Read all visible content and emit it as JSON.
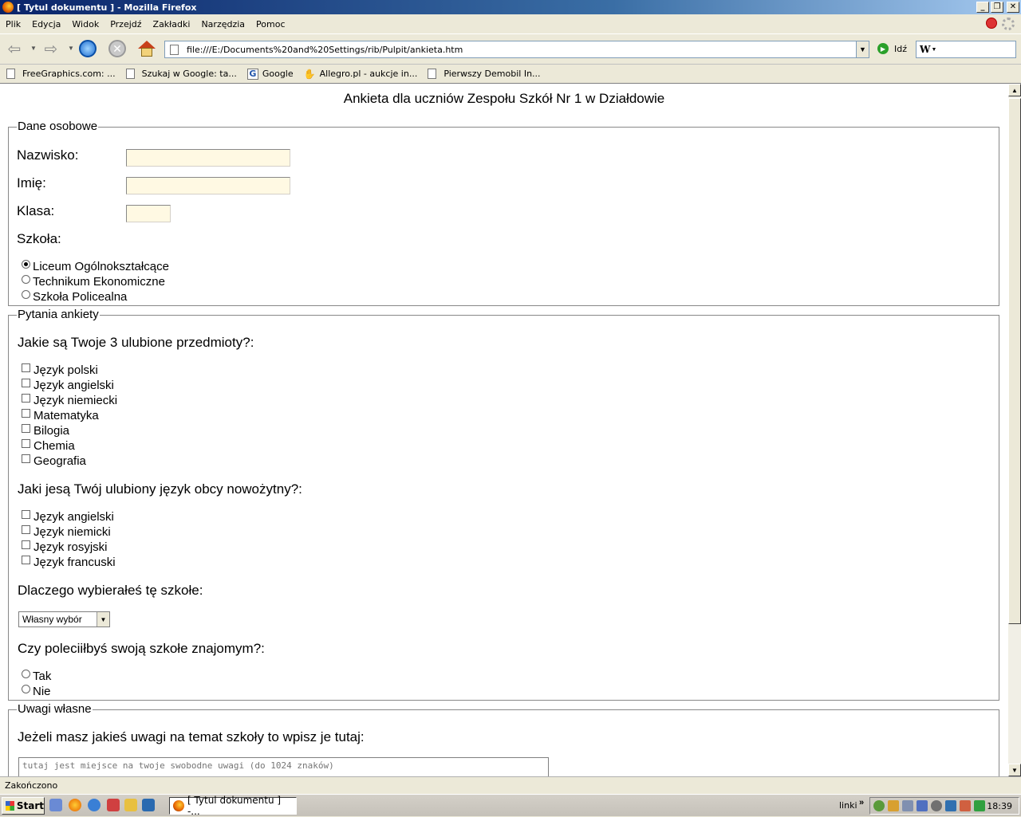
{
  "window": {
    "title": "[ Tytul dokumentu ] - Mozilla Firefox"
  },
  "menu": [
    "Plik",
    "Edycja",
    "Widok",
    "Przejdź",
    "Zakładki",
    "Narzędzia",
    "Pomoc"
  ],
  "nav": {
    "url": "file:///E:/Documents%20and%20Settings/rib/Pulpit/ankieta.htm",
    "go_label": "Idź",
    "search_logo": "W"
  },
  "bookmarks": [
    "FreeGraphics.com: ...",
    "Szukaj w Google: ta...",
    "Google",
    "Allegro.pl - aukcje in...",
    "Pierwszy Demobil In..."
  ],
  "page": {
    "title": "Ankieta dla uczniów Zespołu Szkół Nr 1 w Działdowie",
    "personal": {
      "legend": "Dane osobowe",
      "surname_label": "Nazwisko:",
      "name_label": "Imię:",
      "class_label": "Klasa:",
      "surname_value": "",
      "name_value": "",
      "class_value": "",
      "school_label": "Szkoła:",
      "schools": [
        "Liceum Ogólnokształcące",
        "Technikum Ekonomiczne",
        "Szkoła Policealna"
      ],
      "selected_school": "Liceum Ogólnokształcące"
    },
    "survey": {
      "legend": "Pytania ankiety",
      "q1": "Jakie są Twoje 3 ulubione przedmioty?:",
      "subjects": [
        "Język polski",
        "Język angielski",
        "Język niemiecki",
        "Matematyka",
        "Bilogia",
        "Chemia",
        "Geografia"
      ],
      "q2": "Jaki jesą Twój ulubiony język obcy nowożytny?:",
      "languages": [
        "Język angielski",
        "Język niemicki",
        "Język rosyjski",
        "Język francuski"
      ],
      "q3": "Dlaczego wybierałeś tę szkołe:",
      "q3_selected": "Własny wybór",
      "q4": "Czy poleciiłbyś swoją szkołe znajomym?:",
      "q4_options": [
        "Tak",
        "Nie"
      ]
    },
    "remarks": {
      "legend": "Uwagi własne",
      "question": "Jeżeli masz jakieś uwagi na temat szkoły to wpisz je tutaj:",
      "placeholder": "tutaj jest miejsce na twoje swobodne uwagi (do 1024 znaków)"
    }
  },
  "status": {
    "text": "Zakończono"
  },
  "taskbar": {
    "start_label": "Start",
    "active_window": "[ Tytul dokumentu ] -...",
    "links_label": "linki",
    "clock": "18:39"
  }
}
